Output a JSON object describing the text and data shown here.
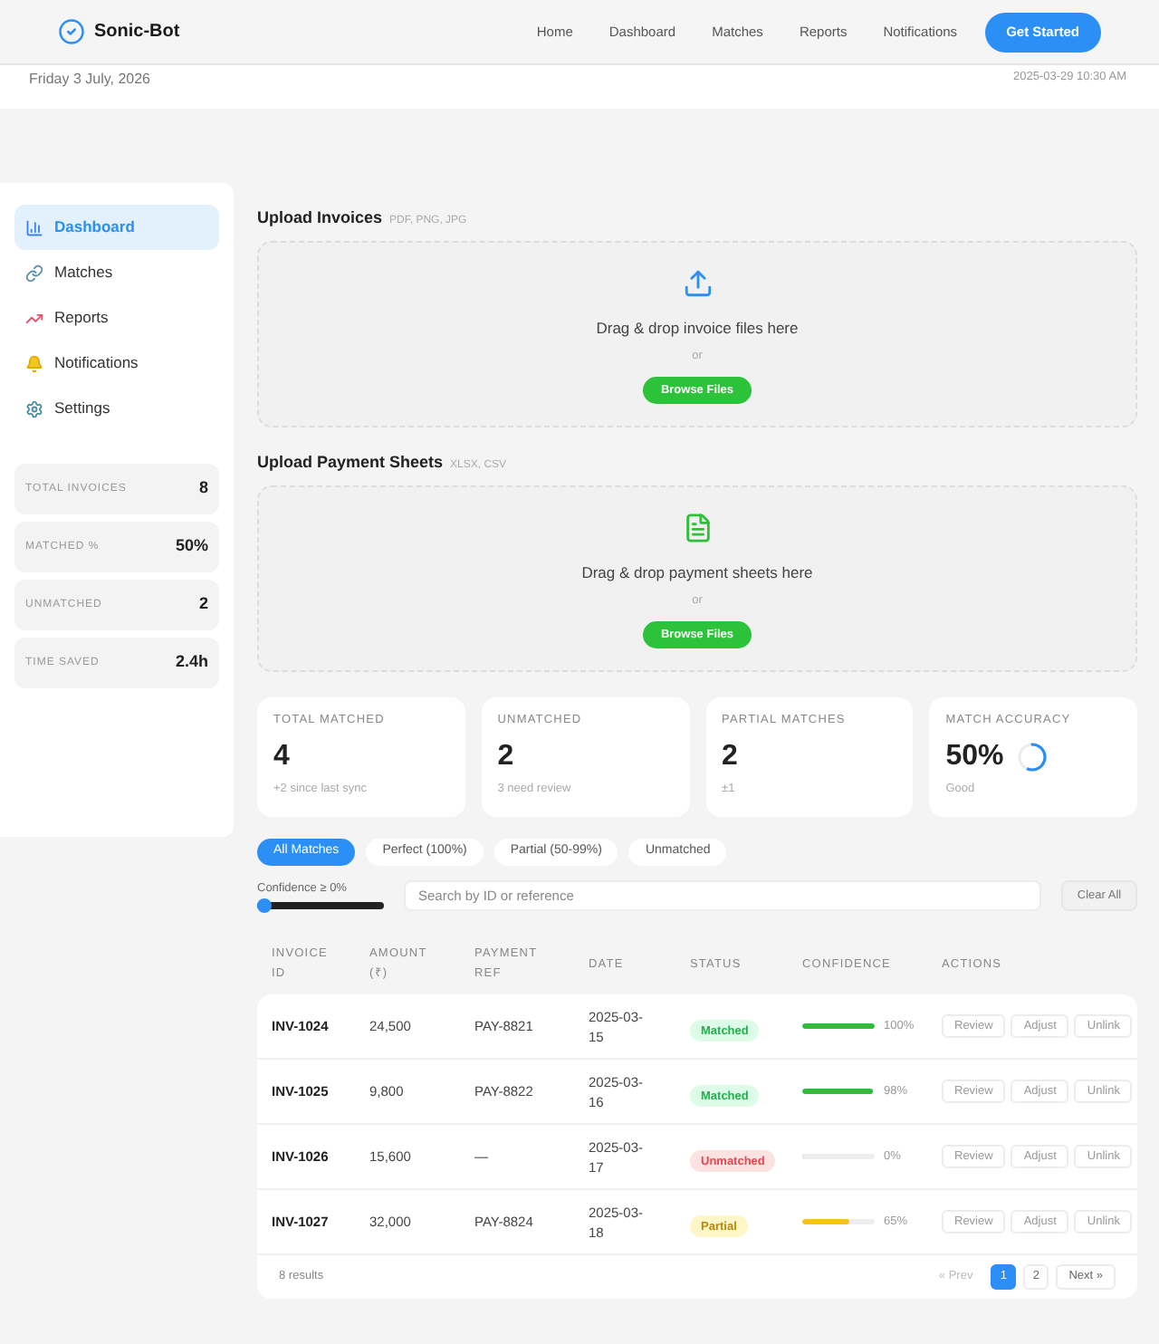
{
  "header": {
    "brand": "Sonic-Bot",
    "nav": [
      {
        "label": "Home"
      },
      {
        "label": "Dashboard"
      },
      {
        "label": "Matches"
      },
      {
        "label": "Reports"
      },
      {
        "label": "Notifications"
      }
    ],
    "cta": "Get Started"
  },
  "date_bar": {
    "date": "Friday 3 July, 2026",
    "timestamp": "2025-03-29 10:30 AM"
  },
  "sidebar": {
    "items": [
      {
        "label": "Dashboard",
        "selected": true
      },
      {
        "label": "Matches",
        "selected": false
      },
      {
        "label": "Reports",
        "selected": false
      },
      {
        "label": "Notifications",
        "selected": false
      },
      {
        "label": "Settings",
        "selected": false
      }
    ],
    "stats": [
      {
        "label": "TOTAL INVOICES",
        "value": "8"
      },
      {
        "label": "MATCHED %",
        "value": "50%"
      },
      {
        "label": "UNMATCHED",
        "value": "2"
      },
      {
        "label": "TIME SAVED",
        "value": "2.4h"
      }
    ]
  },
  "uploads": [
    {
      "kind": "invoice",
      "title": "Upload Invoices",
      "formats": "PDF, PNG, JPG",
      "prompt": "Drag & drop invoice files here",
      "or": "or",
      "button": "Browse Files"
    },
    {
      "kind": "sheet",
      "title": "Upload Payment Sheets",
      "formats": "XLSX, CSV",
      "prompt": "Drag & drop payment sheets here",
      "or": "or",
      "button": "Browse Files"
    }
  ],
  "summary_cards": [
    {
      "kind": "count",
      "label": "TOTAL MATCHED",
      "value": "4",
      "note": "+2 since last sync"
    },
    {
      "kind": "count",
      "label": "UNMATCHED",
      "value": "2",
      "note": "3 need review"
    },
    {
      "kind": "count",
      "label": "PARTIAL MATCHES",
      "value": "2",
      "note": "±1"
    },
    {
      "kind": "accuracy",
      "label": "MATCH ACCURACY",
      "value": "50%",
      "note": "Good"
    }
  ],
  "filters": {
    "pills": [
      {
        "label": "All Matches",
        "selected": true
      },
      {
        "label": "Perfect (100%)",
        "selected": false
      },
      {
        "label": "Partial (50-99%)",
        "selected": false
      },
      {
        "label": "Unmatched",
        "selected": false
      }
    ],
    "confidence": {
      "label": "Confidence ≥ 0%",
      "level": 0
    },
    "search": {
      "placeholder": "Search by ID or reference"
    },
    "clear": "Clear All"
  },
  "table": {
    "columns": [
      "INVOICE ID",
      "AMOUNT (₹)",
      "PAYMENT REF",
      "DATE",
      "STATUS",
      "CONFIDENCE",
      "ACTIONS"
    ],
    "rows": [
      {
        "invoice_id": "INV-1024",
        "amount": "24,500",
        "payment_ref": "PAY-8821",
        "date": "2025-03-15",
        "status": {
          "label": "Matched",
          "kind": "matched"
        },
        "confidence": {
          "level": 1,
          "reading": "100%"
        },
        "actions": [
          "Review",
          "Adjust",
          "Unlink"
        ]
      },
      {
        "invoice_id": "INV-1025",
        "amount": "9,800",
        "payment_ref": "PAY-8822",
        "date": "2025-03-16",
        "status": {
          "label": "Matched",
          "kind": "matched"
        },
        "confidence": {
          "level": 0.98,
          "reading": "98%"
        },
        "actions": [
          "Review",
          "Adjust",
          "Unlink"
        ]
      },
      {
        "invoice_id": "INV-1026",
        "amount": "15,600",
        "payment_ref": "—",
        "date": "2025-03-17",
        "status": {
          "label": "Unmatched",
          "kind": "unmatched"
        },
        "confidence": {
          "level": 0,
          "reading": "0%"
        },
        "actions": [
          "Review",
          "Adjust",
          "Unlink"
        ]
      },
      {
        "invoice_id": "INV-1027",
        "amount": "32,000",
        "payment_ref": "PAY-8824",
        "date": "2025-03-18",
        "status": {
          "label": "Partial",
          "kind": "partial"
        },
        "confidence": {
          "level": 0.65,
          "reading": "65%"
        },
        "actions": [
          "Review",
          "Adjust",
          "Unlink"
        ]
      }
    ],
    "footer": {
      "count": "8 results",
      "prev": {
        "label": "« Prev",
        "disabled": true
      },
      "pages": [
        {
          "label": "1",
          "selected": true
        },
        {
          "label": "2",
          "selected": false
        }
      ],
      "next": {
        "label": "Next »",
        "disabled": false
      }
    }
  }
}
